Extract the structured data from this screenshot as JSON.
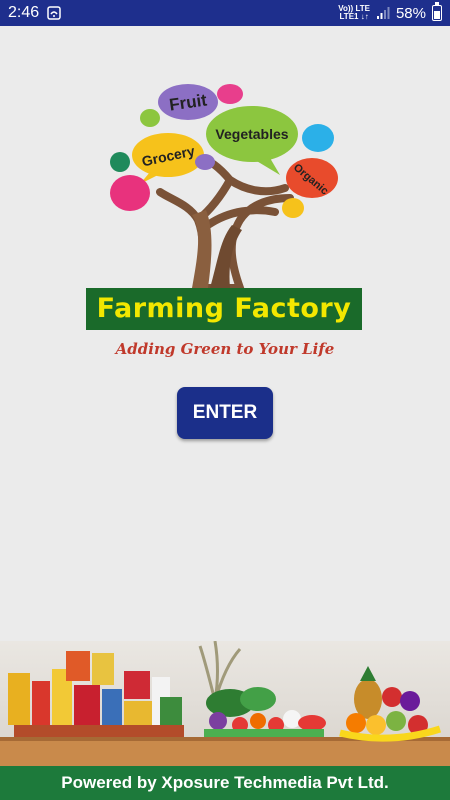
{
  "status_bar": {
    "time": "2:46",
    "network_top": "Vo)) LTE",
    "network_bottom": "LTE1 ↓↑",
    "battery": "58%",
    "battery_level": 0.58
  },
  "logo": {
    "bubbles": {
      "fruit": "Fruit",
      "grocery": "Grocery",
      "vegetables": "Vegetables",
      "organic": "Organic"
    },
    "brand": "Farming Factory",
    "tagline": "Adding Green to Your Life"
  },
  "enter_button": {
    "label": "ENTER"
  },
  "footer": {
    "text": "Powered by Xposure Techmedia Pvt Ltd."
  },
  "colors": {
    "status_bar": "#1e2f8d",
    "button": "#1b2f8a",
    "footer": "#1d7a3b",
    "brand_band": "#1a6a2a",
    "brand_text": "#f3e700",
    "tagline": "#c0392b"
  }
}
